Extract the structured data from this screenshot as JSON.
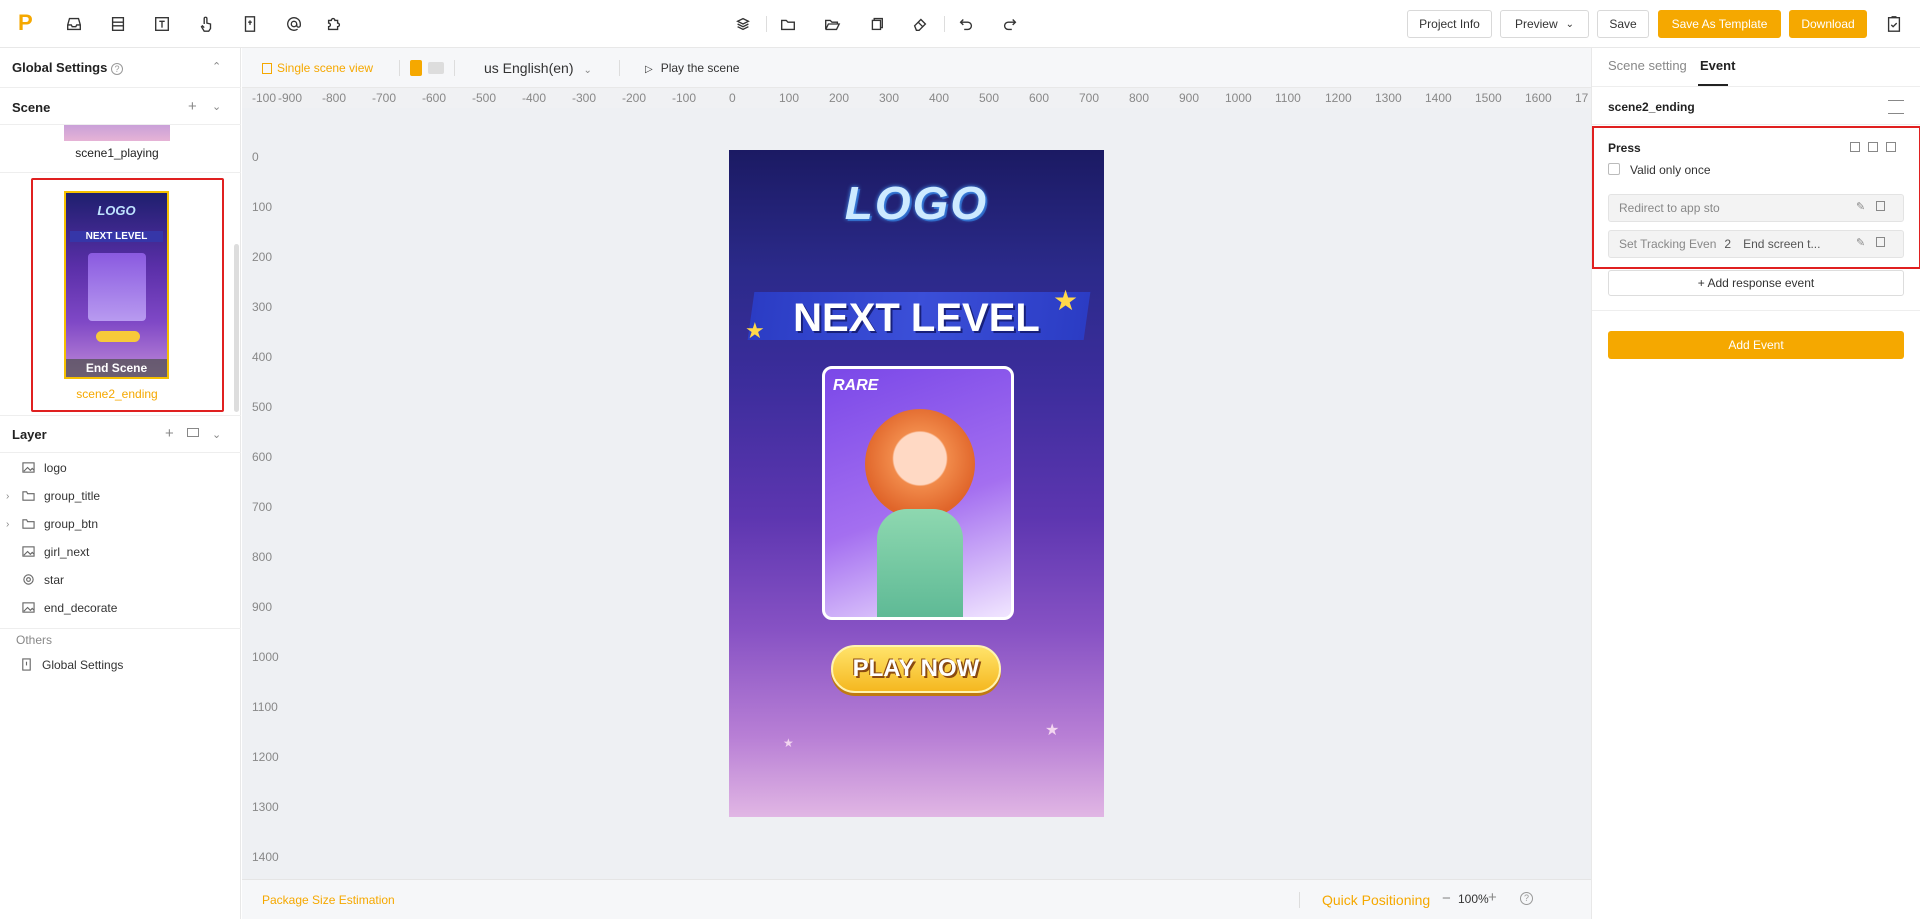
{
  "toolbar": {
    "project_info": "Project Info",
    "preview": "Preview",
    "save": "Save",
    "save_template": "Save As Template",
    "download": "Download"
  },
  "left": {
    "global_settings": "Global Settings",
    "scene_title": "Scene",
    "scenes": [
      {
        "name": "scene1_playing"
      },
      {
        "name": "scene2_ending",
        "thumb_label": "End Scene",
        "thumb_logo": "LOGO",
        "thumb_title": "NEXT LEVEL"
      }
    ],
    "layer_title": "Layer",
    "layers": [
      "logo",
      "group_title",
      "group_btn",
      "girl_next",
      "star",
      "end_decorate"
    ],
    "others_title": "Others",
    "others_item": "Global Settings"
  },
  "canvas": {
    "single_scene_view": "Single scene view",
    "language": "us English(en)",
    "play_scene": "Play the scene",
    "ruler_x": [
      "-100",
      "-900",
      "-800",
      "-700",
      "-600",
      "-500",
      "-400",
      "-300",
      "-200",
      "-100",
      "0",
      "100",
      "200",
      "300",
      "400",
      "500",
      "600",
      "700",
      "800",
      "900",
      "1000",
      "1100",
      "1200",
      "1300",
      "1400",
      "1500",
      "1600",
      "17"
    ],
    "ruler_y": [
      "0",
      "100",
      "200",
      "300",
      "400",
      "500",
      "600",
      "700",
      "800",
      "900",
      "1000",
      "1100",
      "1200",
      "1300",
      "1400"
    ],
    "art": {
      "logo": "LOGO",
      "title": "NEXT LEVEL",
      "card_tag": "RARE",
      "cta": "PLAY NOW"
    },
    "package_size": "Package Size Estimation",
    "quick_positioning": "Quick Positioning",
    "zoom": "100%"
  },
  "right": {
    "tab_scene_setting": "Scene setting",
    "tab_event": "Event",
    "scene_name": "scene2_ending",
    "event_name": "Press",
    "valid_once": "Valid only once",
    "responses": [
      {
        "label": "Redirect to app sto"
      },
      {
        "label": "Set Tracking Even",
        "num": "2",
        "value": "End screen t..."
      }
    ],
    "add_response": "+ Add response event",
    "add_event": "Add Event"
  },
  "colors": {
    "accent": "#f5a800",
    "highlight": "#e02020"
  }
}
